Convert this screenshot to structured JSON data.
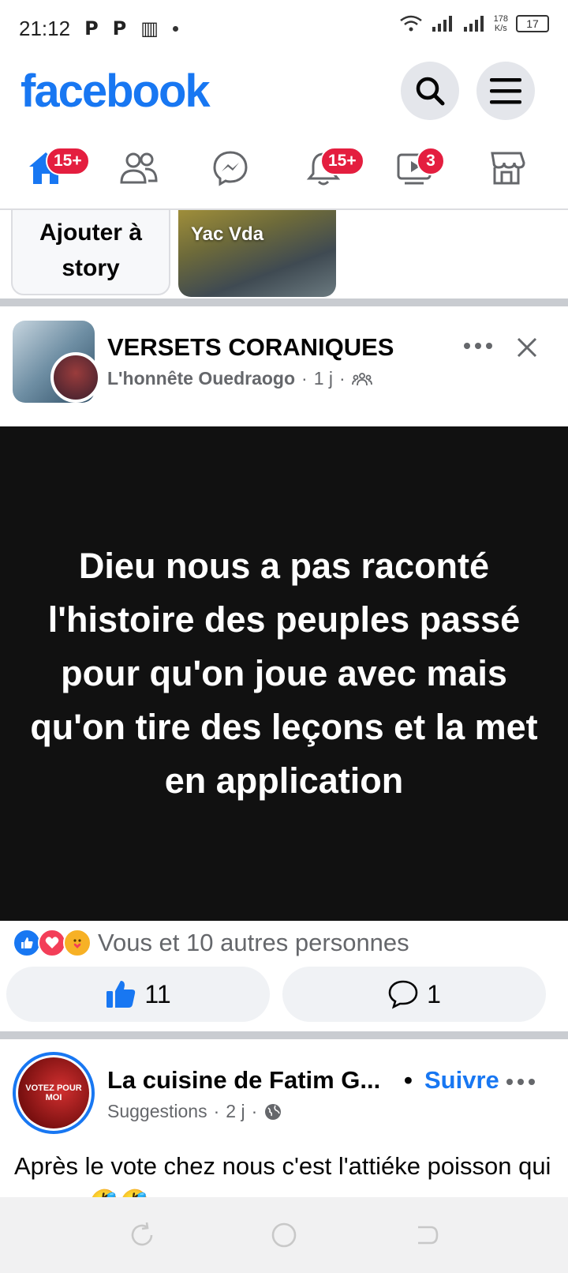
{
  "status_bar": {
    "time": "21:12",
    "left_glyphs": [
      "P",
      "P",
      "▥"
    ],
    "net_speed_value": "178",
    "net_speed_unit": "K/s",
    "battery": "17"
  },
  "header": {
    "logo": "facebook",
    "search_icon": "search-icon",
    "menu_icon": "menu-icon"
  },
  "nav": {
    "home_badge": "15+",
    "notifications_badge": "15+",
    "video_badge": "3",
    "icons": [
      "home-icon",
      "friends-icon",
      "messenger-icon",
      "bell-icon",
      "video-icon",
      "marketplace-icon"
    ]
  },
  "stories": {
    "add_label": "Ajouter à story",
    "card_name": "Yac Vda"
  },
  "post1": {
    "title": "VERSETS CORANIQUES",
    "author": "L'honnête Ouedraogo",
    "sep": "·",
    "time": "1 j",
    "quote": "Dieu nous a pas raconté l'histoire des peuples passé pour qu'on joue avec mais qu'on tire des leçons et la met en application",
    "reactions_text": "Vous et 10 autres personnes",
    "like_count": "11",
    "comment_count": "1"
  },
  "post2": {
    "page_name": "La cuisine de Fatim G...",
    "follow_dot": "•",
    "follow_label": "Suivre",
    "sub_label": "Suggestions",
    "sep": "·",
    "time": "2 j",
    "avatar_text": "VOTEZ POUR MOI",
    "text": "Après le vote chez nous c'est l'attiéke poisson qui gagne 🤣🤣"
  },
  "colors": {
    "brand": "#1877f2",
    "badge": "#e41e3f",
    "quote_bg": "#111111"
  }
}
